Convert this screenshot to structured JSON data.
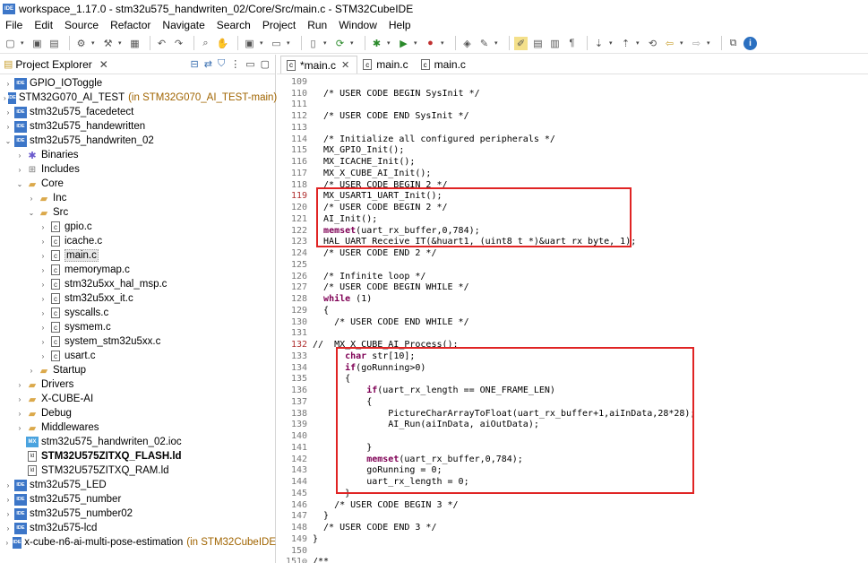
{
  "window": {
    "title": "workspace_1.17.0 - stm32u575_handwriten_02/Core/Src/main.c - STM32CubeIDE",
    "logo_text": "IDE"
  },
  "menu": [
    "File",
    "Edit",
    "Source",
    "Refactor",
    "Navigate",
    "Search",
    "Project",
    "Run",
    "Window",
    "Help"
  ],
  "explorer": {
    "title": "Project Explorer",
    "tree": [
      {
        "depth": 0,
        "arrow": "›",
        "icon": "ide",
        "label": "GPIO_IOToggle"
      },
      {
        "depth": 0,
        "arrow": "›",
        "icon": "ide",
        "label": "STM32G070_AI_TEST",
        "note": "(in STM32G070_AI_TEST-main)"
      },
      {
        "depth": 0,
        "arrow": "›",
        "icon": "ide",
        "label": "stm32u575_facedetect"
      },
      {
        "depth": 0,
        "arrow": "›",
        "icon": "ide",
        "label": "stm32u575_handewritten"
      },
      {
        "depth": 0,
        "arrow": "⌄",
        "icon": "ide",
        "label": "stm32u575_handwriten_02"
      },
      {
        "depth": 1,
        "arrow": "›",
        "icon": "gear",
        "label": "Binaries"
      },
      {
        "depth": 1,
        "arrow": "›",
        "icon": "incl",
        "label": "Includes"
      },
      {
        "depth": 1,
        "arrow": "⌄",
        "icon": "folder",
        "label": "Core"
      },
      {
        "depth": 2,
        "arrow": "›",
        "icon": "folder",
        "label": "Inc"
      },
      {
        "depth": 2,
        "arrow": "⌄",
        "icon": "folder",
        "label": "Src"
      },
      {
        "depth": 3,
        "arrow": "›",
        "icon": "cfile",
        "label": "gpio.c"
      },
      {
        "depth": 3,
        "arrow": "›",
        "icon": "cfile",
        "label": "icache.c"
      },
      {
        "depth": 3,
        "arrow": "›",
        "icon": "cfile",
        "label": "main.c",
        "selected": true
      },
      {
        "depth": 3,
        "arrow": "›",
        "icon": "cfile",
        "label": "memorymap.c"
      },
      {
        "depth": 3,
        "arrow": "›",
        "icon": "cfile",
        "label": "stm32u5xx_hal_msp.c"
      },
      {
        "depth": 3,
        "arrow": "›",
        "icon": "cfile",
        "label": "stm32u5xx_it.c"
      },
      {
        "depth": 3,
        "arrow": "›",
        "icon": "cfile",
        "label": "syscalls.c"
      },
      {
        "depth": 3,
        "arrow": "›",
        "icon": "cfile",
        "label": "sysmem.c"
      },
      {
        "depth": 3,
        "arrow": "›",
        "icon": "cfile",
        "label": "system_stm32u5xx.c"
      },
      {
        "depth": 3,
        "arrow": "›",
        "icon": "cfile",
        "label": "usart.c"
      },
      {
        "depth": 2,
        "arrow": "›",
        "icon": "folder",
        "label": "Startup"
      },
      {
        "depth": 1,
        "arrow": "›",
        "icon": "folder",
        "label": "Drivers"
      },
      {
        "depth": 1,
        "arrow": "›",
        "icon": "folder",
        "label": "X-CUBE-AI"
      },
      {
        "depth": 1,
        "arrow": "›",
        "icon": "folder",
        "label": "Debug"
      },
      {
        "depth": 1,
        "arrow": "›",
        "icon": "folder",
        "label": "Middlewares"
      },
      {
        "depth": 1,
        "arrow": "",
        "icon": "mx",
        "label": "stm32u575_handwriten_02.ioc"
      },
      {
        "depth": 1,
        "arrow": "",
        "icon": "ld",
        "label": "STM32U575ZITXQ_FLASH.ld",
        "bold": true
      },
      {
        "depth": 1,
        "arrow": "",
        "icon": "ld",
        "label": "STM32U575ZITXQ_RAM.ld"
      },
      {
        "depth": 0,
        "arrow": "›",
        "icon": "ide",
        "label": "stm32u575_LED"
      },
      {
        "depth": 0,
        "arrow": "›",
        "icon": "ide",
        "label": "stm32u575_number"
      },
      {
        "depth": 0,
        "arrow": "›",
        "icon": "ide",
        "label": "stm32u575_number02"
      },
      {
        "depth": 0,
        "arrow": "›",
        "icon": "ide",
        "label": "stm32u575-lcd"
      },
      {
        "depth": 0,
        "arrow": "›",
        "icon": "ide",
        "label": "x-cube-n6-ai-multi-pose-estimation",
        "note": "(in STM32CubeIDE"
      }
    ]
  },
  "editor": {
    "tabs": [
      {
        "label": "*main.c",
        "active": true
      },
      {
        "label": "main.c",
        "active": false
      },
      {
        "label": "main.c",
        "active": false
      }
    ],
    "lines": [
      {
        "n": "109",
        "t": ""
      },
      {
        "n": "110",
        "t": "  /* USER CODE BEGIN SysInit */",
        "k": "comment"
      },
      {
        "n": "111",
        "t": ""
      },
      {
        "n": "112",
        "t": "  /* USER CODE END SysInit */",
        "k": "comment"
      },
      {
        "n": "113",
        "t": ""
      },
      {
        "n": "114",
        "t": "  /* Initialize all configured peripherals */",
        "k": "comment"
      },
      {
        "n": "115",
        "t": "  MX_GPIO_Init();"
      },
      {
        "n": "116",
        "t": "  MX_ICACHE_Init();"
      },
      {
        "n": "117",
        "t": "  MX_X_CUBE_AI_Init();"
      },
      {
        "n": "118",
        "t": "  /* USER CODE BEGIN 2 */",
        "k": "comment"
      },
      {
        "n": "119",
        "t": "  MX_USART1_UART_Init();",
        "marked": true
      },
      {
        "n": "120",
        "t": "  /* USER CODE BEGIN 2 */",
        "k": "comment"
      },
      {
        "n": "121",
        "t": "  AI_Init();"
      },
      {
        "n": "122",
        "t": "  memset(uart_rx_buffer,0,784);",
        "kw": "memset"
      },
      {
        "n": "123",
        "t": "  HAL_UART_Receive_IT(&huart1, (uint8_t *)&uart_rx_byte, 1);"
      },
      {
        "n": "124",
        "t": "  /* USER CODE END 2 */",
        "k": "comment"
      },
      {
        "n": "125",
        "t": ""
      },
      {
        "n": "126",
        "t": "  /* Infinite loop */",
        "k": "comment"
      },
      {
        "n": "127",
        "t": "  /* USER CODE BEGIN WHILE */",
        "k": "comment"
      },
      {
        "n": "128",
        "t": "  while (1)",
        "kw": "while"
      },
      {
        "n": "129",
        "t": "  {"
      },
      {
        "n": "130",
        "t": "    /* USER CODE END WHILE */",
        "k": "comment"
      },
      {
        "n": "131",
        "t": ""
      },
      {
        "n": "132",
        "t": "//  MX_X_CUBE_AI_Process();",
        "k": "comment",
        "marked": true
      },
      {
        "n": "133",
        "t": "      char str[10];",
        "kw": "char"
      },
      {
        "n": "134",
        "t": "      if(goRunning>0)",
        "kw": "if"
      },
      {
        "n": "135",
        "t": "      {"
      },
      {
        "n": "136",
        "t": "          if(uart_rx_length == ONE_FRAME_LEN)",
        "kw": "if"
      },
      {
        "n": "137",
        "t": "          {"
      },
      {
        "n": "138",
        "t": "              PictureCharArrayToFloat(uart_rx_buffer+1,aiInData,28*28);"
      },
      {
        "n": "139",
        "t": "              AI_Run(aiInData, aiOutData);"
      },
      {
        "n": "140",
        "t": ""
      },
      {
        "n": "141",
        "t": "          }"
      },
      {
        "n": "142",
        "t": "          memset(uart_rx_buffer,0,784);",
        "kw": "memset"
      },
      {
        "n": "143",
        "t": "          goRunning = 0;"
      },
      {
        "n": "144",
        "t": "          uart_rx_length = 0;"
      },
      {
        "n": "145",
        "t": "      }"
      },
      {
        "n": "146",
        "t": "    /* USER CODE BEGIN 3 */",
        "k": "comment"
      },
      {
        "n": "147",
        "t": "  }"
      },
      {
        "n": "148",
        "t": "  /* USER CODE END 3 */",
        "k": "comment"
      },
      {
        "n": "149",
        "t": "}"
      },
      {
        "n": "150",
        "t": ""
      },
      {
        "n": "151⊖",
        "t": "/**",
        "k": "comment"
      }
    ]
  },
  "colors": {
    "highlight": "#e02424",
    "comment": "#3f7f5f",
    "keyword": "#7f0055"
  }
}
